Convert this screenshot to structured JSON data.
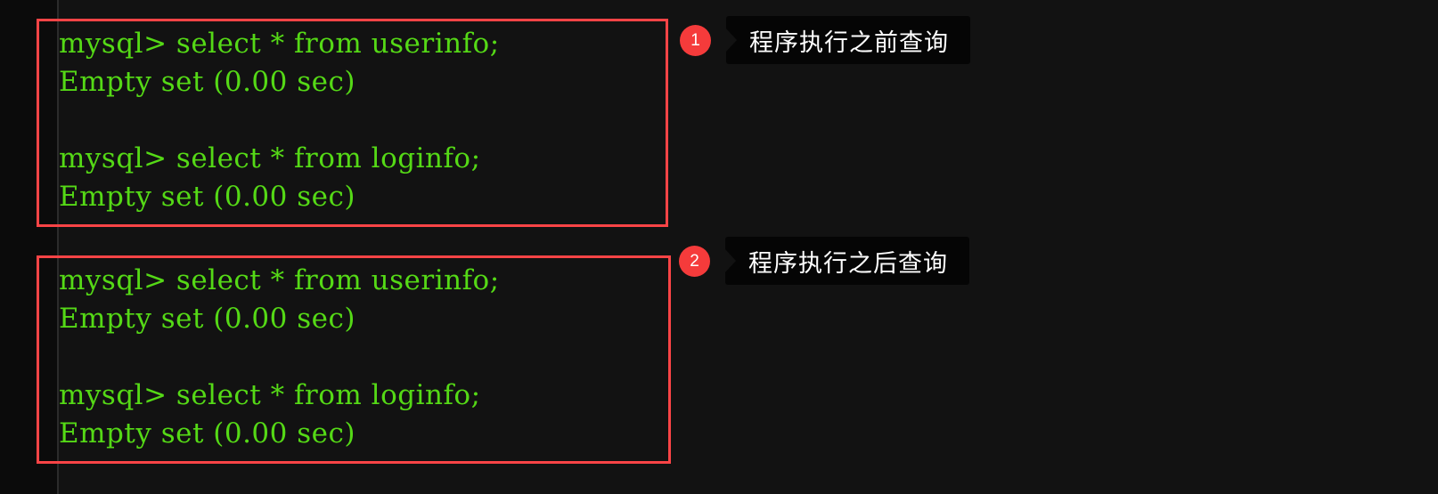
{
  "theme": {
    "page_background": "#121212",
    "gutter_background": "#0b0b0b",
    "gutter_rule": "#2b2b2b",
    "terminal_text": "#55d916",
    "highlight_border": "#fb4446",
    "badge_background": "#f53b3b",
    "badge_text": "#ffffff",
    "callout_background": "#050505",
    "callout_text": "#ffffff"
  },
  "console_blocks": [
    {
      "id": "before",
      "lines": [
        "mysql> select * from userinfo;",
        "Empty set (0.00 sec)",
        "",
        "mysql> select * from loginfo;",
        "Empty set (0.00 sec)"
      ]
    },
    {
      "id": "after",
      "lines": [
        "mysql> select * from userinfo;",
        "Empty set (0.00 sec)",
        "",
        "mysql> select * from loginfo;",
        "Empty set (0.00 sec)"
      ]
    }
  ],
  "callouts": [
    {
      "number": "1",
      "text": "程序执行之前查询"
    },
    {
      "number": "2",
      "text": "程序执行之后查询"
    }
  ]
}
